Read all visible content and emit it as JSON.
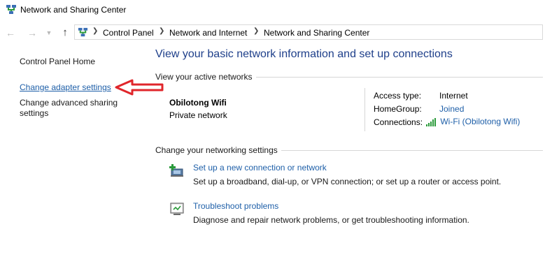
{
  "window": {
    "title": "Network and Sharing Center"
  },
  "address_bar": {
    "crumbs": [
      "Control Panel",
      "Network and Internet",
      "Network and Sharing Center"
    ]
  },
  "left_pane": {
    "home": "Control Panel Home",
    "adapter": "Change adapter settings",
    "advanced_line1": "Change advanced sharing",
    "advanced_line2": "settings"
  },
  "main": {
    "heading": "View your basic network information and set up connections",
    "active_networks_label": "View your active networks",
    "network": {
      "name": "Obilotong Wifi",
      "type": "Private network",
      "access_type_label": "Access type:",
      "access_type_value": "Internet",
      "homegroup_label": "HomeGroup:",
      "homegroup_value": "Joined",
      "connections_label": "Connections:",
      "connections_value": "Wi-Fi (Obilotong Wifi)"
    },
    "change_settings_label": "Change your networking settings",
    "tasks": [
      {
        "title": "Set up a new connection or network",
        "description": "Set up a broadband, dial-up, or VPN connection; or set up a router or access point."
      },
      {
        "title": "Troubleshoot problems",
        "description": "Diagnose and repair network problems, or get troubleshooting information."
      }
    ]
  },
  "colors": {
    "link": "#1e5fa8",
    "heading": "#1e3f8a",
    "annotation_arrow": "#e0262b"
  },
  "icons": {
    "title": "network-icon",
    "back": "back-arrow-icon",
    "forward": "forward-arrow-icon",
    "recent": "chevron-down-icon",
    "up": "up-arrow-icon",
    "wifi_signal": "wifi-signal-icon",
    "new_connection": "new-connection-icon",
    "troubleshoot": "troubleshoot-icon",
    "annotation": "red-arrow-icon"
  }
}
